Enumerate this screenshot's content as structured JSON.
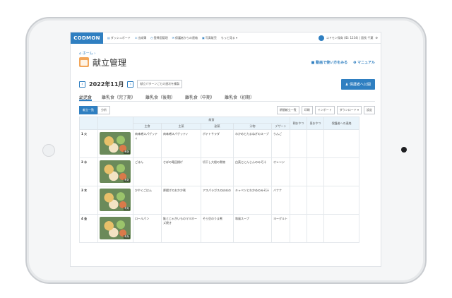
{
  "app": {
    "logo": "CODMON",
    "nav": [
      {
        "icon": "chart-icon",
        "label": "ダッシュボード"
      },
      {
        "icon": "users-icon",
        "label": "出席簿"
      },
      {
        "icon": "clock-icon",
        "label": "登降園管理"
      },
      {
        "icon": "mail-icon",
        "label": "保護者からの連絡"
      },
      {
        "icon": "doc-icon",
        "label": "写真販売"
      },
      {
        "icon": "more-icon",
        "label": "もっと見る ▾"
      }
    ],
    "user": "コドモン保育 (ID: 1234) | 園長 千葉"
  },
  "page": {
    "breadcrumb": "ホーム ›",
    "title": "献立管理",
    "help_video": "動画で使い方をみる",
    "help_manual": "マニュアル",
    "month": "2022年11月",
    "prev": "‹",
    "next": "›",
    "copy_pattern_label": "献立パターンごとの週次を複製",
    "publish_label": "保護者へ公開"
  },
  "tabs": [
    "幼児食",
    "離乳食（完了期）",
    "離乳食（後期）",
    "離乳食（中期）",
    "離乳食（初期）"
  ],
  "view_toggle": [
    "献立一覧",
    "分析"
  ],
  "tools": [
    "期間献立一覧",
    "印刷",
    "インポート",
    "ダウンロード ▾",
    "設定"
  ],
  "table": {
    "group_header": "献食",
    "columns": [
      "主食",
      "主菜",
      "副菜",
      "汁物",
      "デザート"
    ],
    "extra_columns": [
      "朝おやつ",
      "昼おやつ",
      "保護者への連絡"
    ],
    "photo_label": "有効",
    "rows": [
      {
        "day": "1 火",
        "cells": [
          "肉味噌スパゲッティ",
          "肉味噌スパゲッティ",
          "ポテトサラダ",
          "わかめとたまねぎのスープ",
          "りんご"
        ]
      },
      {
        "day": "2 水",
        "cells": [
          "ごはん",
          "さばの竜田揚げ",
          "切干し大根の煮物",
          "白菜とにんじんのみそ汁",
          "オレンジ"
        ]
      },
      {
        "day": "3 木",
        "cells": [
          "かやくごはん",
          "厚揚げのおかか煮",
          "アスパラガスの炒めの",
          "キャベツとわかめのみそ汁",
          "バナナ"
        ]
      },
      {
        "day": "4 金",
        "cells": [
          "ロールパン",
          "鮭とじゃがいものマヨネーズ焼き",
          "そら豆のうま煮",
          "和風スープ",
          "ヨーグルト"
        ]
      }
    ]
  }
}
